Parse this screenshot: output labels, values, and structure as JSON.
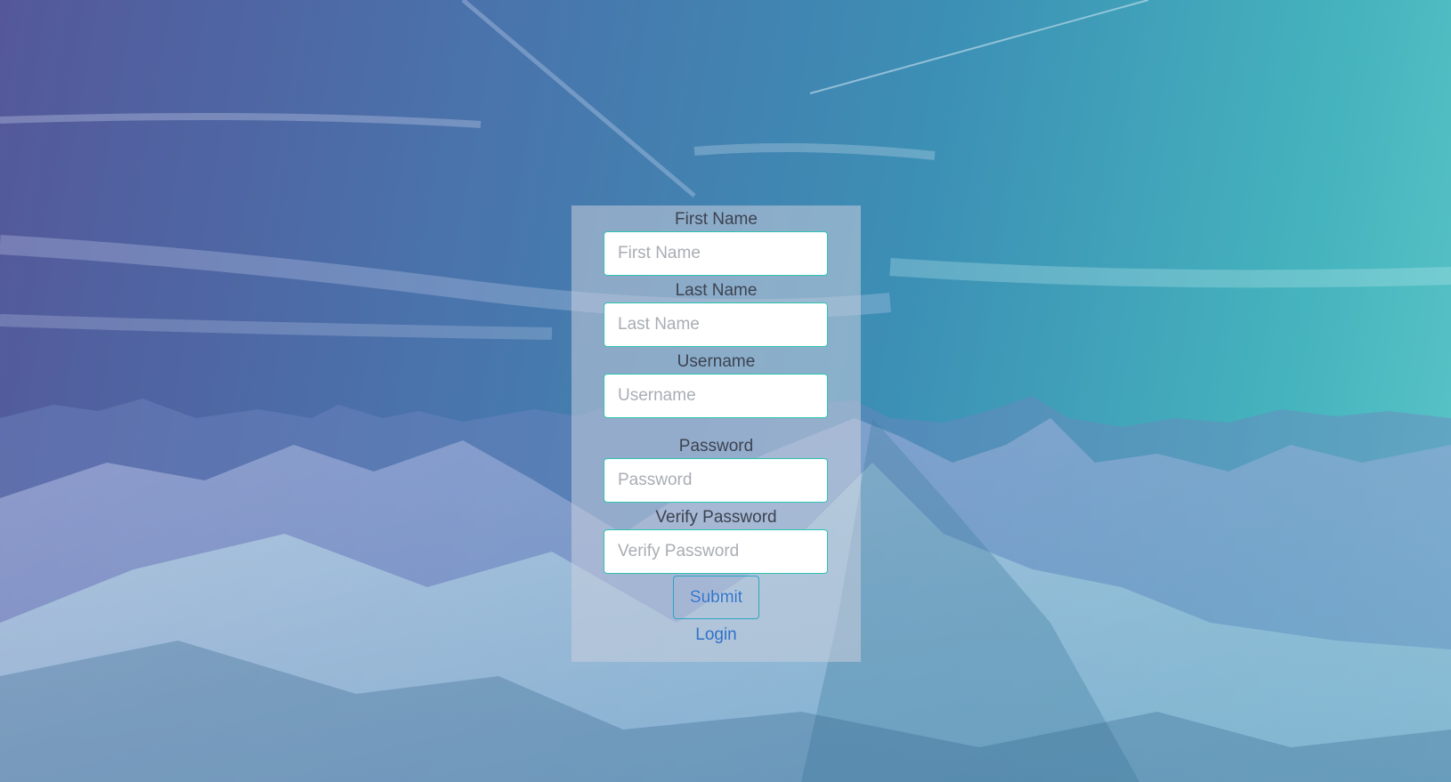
{
  "form": {
    "fields": [
      {
        "label": "First Name",
        "placeholder": "First Name",
        "value": ""
      },
      {
        "label": "Last Name",
        "placeholder": "Last Name",
        "value": ""
      },
      {
        "label": "Username",
        "placeholder": "Username",
        "value": ""
      },
      {
        "label": "Password",
        "placeholder": "Password",
        "value": ""
      },
      {
        "label": "Verify Password",
        "placeholder": "Verify Password",
        "value": ""
      }
    ],
    "submit_label": "Submit",
    "login_label": "Login"
  },
  "colors": {
    "input_border": "#2ec4b0",
    "link": "#2f72c9",
    "panel_overlay": "rgba(200,205,220,0.55)"
  }
}
